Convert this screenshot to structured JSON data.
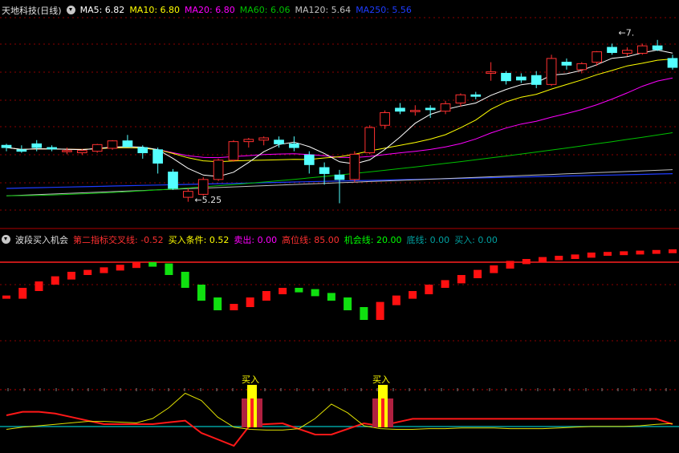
{
  "colors": {
    "bg": "#000000",
    "up": "#ff3030",
    "down": "#54ffff",
    "grid": "#8b0000",
    "ma5": "#ffffff",
    "ma10": "#ffff00",
    "ma20": "#ff00ff",
    "ma60": "#00c000",
    "ma120": "#c0c0c0",
    "ma250": "#1e3cff"
  },
  "main_header": {
    "title": "天地科技(日线)",
    "items": [
      {
        "label": "MA5: 6.82",
        "color": "#ffffff"
      },
      {
        "label": "MA10: 6.80",
        "color": "#ffff00"
      },
      {
        "label": "MA20: 6.80",
        "color": "#ff00ff"
      },
      {
        "label": "MA60: 6.06",
        "color": "#00c000"
      },
      {
        "label": "MA120: 5.64",
        "color": "#c0c0c0"
      },
      {
        "label": "MA250: 5.56",
        "color": "#1e3cff"
      }
    ]
  },
  "sub_header": {
    "title": "波段买入机会",
    "items": [
      {
        "label": "第二指标交叉线: -0.52",
        "color": "#ff3030"
      },
      {
        "label": "买入条件: 0.52",
        "color": "#ffff00"
      },
      {
        "label": "卖出: 0.00",
        "color": "#ff00ff"
      },
      {
        "label": "高位线: 85.00",
        "color": "#ff3030"
      },
      {
        "label": "机会线: 20.00",
        "color": "#00ff00"
      },
      {
        "label": "底线: 0.00",
        "color": "#00a0a0"
      },
      {
        "label": "买入: 0.00",
        "color": "#00a0a0"
      }
    ]
  },
  "chart_data": [
    {
      "type": "candlestick",
      "ylim": [
        5.0,
        7.7
      ],
      "annotations": [
        {
          "text": "5.25",
          "value": 5.25,
          "index": 12
        },
        {
          "text": "7.",
          "value": 7.5,
          "index": 40
        }
      ],
      "candles": [
        [
          5.98,
          6.0,
          5.9,
          5.95
        ],
        [
          5.92,
          5.98,
          5.88,
          5.9
        ],
        [
          6.0,
          6.05,
          5.9,
          5.95
        ],
        [
          5.95,
          5.98,
          5.9,
          5.93
        ],
        [
          5.9,
          5.95,
          5.86,
          5.91
        ],
        [
          5.88,
          5.93,
          5.85,
          5.91
        ],
        [
          5.9,
          6.0,
          5.88,
          5.99
        ],
        [
          5.94,
          6.05,
          5.92,
          6.04
        ],
        [
          6.04,
          6.12,
          5.98,
          5.96
        ],
        [
          5.95,
          5.98,
          5.8,
          5.88
        ],
        [
          5.92,
          5.95,
          5.6,
          5.74
        ],
        [
          5.62,
          5.66,
          5.38,
          5.4
        ],
        [
          5.28,
          5.4,
          5.22,
          5.36
        ],
        [
          5.32,
          5.55,
          5.3,
          5.52
        ],
        [
          5.52,
          5.8,
          5.5,
          5.78
        ],
        [
          5.78,
          6.05,
          5.76,
          6.03
        ],
        [
          6.03,
          6.08,
          5.95,
          6.06
        ],
        [
          6.05,
          6.1,
          5.98,
          6.08
        ],
        [
          6.05,
          6.1,
          5.95,
          6.0
        ],
        [
          6.0,
          6.1,
          5.9,
          5.95
        ],
        [
          5.85,
          5.9,
          5.6,
          5.72
        ],
        [
          5.68,
          5.75,
          5.45,
          5.6
        ],
        [
          5.58,
          5.65,
          5.2,
          5.52
        ],
        [
          5.52,
          5.9,
          5.48,
          5.86
        ],
        [
          5.88,
          6.25,
          5.86,
          6.22
        ],
        [
          6.25,
          6.45,
          6.2,
          6.42
        ],
        [
          6.48,
          6.55,
          6.4,
          6.44
        ],
        [
          6.45,
          6.52,
          6.38,
          6.45
        ],
        [
          6.48,
          6.52,
          6.35,
          6.46
        ],
        [
          6.44,
          6.58,
          6.4,
          6.54
        ],
        [
          6.55,
          6.68,
          6.5,
          6.66
        ],
        [
          6.66,
          6.7,
          6.6,
          6.64
        ],
        [
          6.95,
          7.1,
          6.85,
          6.97
        ],
        [
          6.95,
          6.98,
          6.8,
          6.85
        ],
        [
          6.9,
          6.95,
          6.82,
          6.86
        ],
        [
          6.92,
          6.98,
          6.75,
          6.8
        ],
        [
          6.8,
          7.2,
          6.78,
          7.15
        ],
        [
          7.1,
          7.15,
          7.0,
          7.06
        ],
        [
          7.0,
          7.1,
          6.95,
          7.08
        ],
        [
          7.1,
          7.25,
          7.05,
          7.24
        ],
        [
          7.3,
          7.35,
          7.2,
          7.23
        ],
        [
          7.22,
          7.3,
          7.18,
          7.26
        ],
        [
          7.22,
          7.35,
          7.2,
          7.32
        ],
        [
          7.32,
          7.4,
          7.25,
          7.27
        ],
        [
          7.15,
          7.2,
          7.0,
          7.03
        ]
      ]
    },
    {
      "type": "bar",
      "series": [
        {
          "name": "第二指标交叉线",
          "values": [
            -0.52,
            -0.4,
            -0.3,
            -0.22,
            -0.15,
            -0.12,
            -0.08,
            -0.04,
            0.0,
            -0.02,
            -0.15,
            -0.35,
            -0.55,
            -0.7,
            -0.65,
            -0.55,
            -0.45,
            -0.4,
            -0.42,
            -0.48,
            -0.55,
            -0.7,
            -0.85,
            -0.62,
            -0.52,
            -0.45,
            -0.35,
            -0.28,
            -0.2,
            -0.12,
            -0.05,
            0.02,
            0.05,
            0.08,
            0.1,
            0.12,
            0.15,
            0.16,
            0.17,
            0.18,
            0.19,
            0.2
          ]
        }
      ]
    },
    {
      "type": "line",
      "ylim": [
        0,
        100
      ],
      "buy_labels": [
        "买入",
        "买入"
      ],
      "series": [
        {
          "values": [
            20,
            22,
            22,
            21,
            19,
            17,
            15,
            15,
            15,
            15,
            16,
            17,
            16,
            15,
            14,
            14,
            15,
            15,
            15,
            14,
            13,
            12,
            12,
            14,
            16,
            18,
            18,
            18,
            18,
            18,
            18,
            18,
            18,
            18,
            18,
            18,
            18,
            18,
            18,
            18,
            18,
            15
          ]
        },
        {
          "values": [
            5,
            8,
            10,
            12,
            14,
            16,
            16,
            15,
            14,
            20,
            35,
            55,
            45,
            22,
            8,
            5,
            4,
            4,
            6,
            20,
            40,
            28,
            10,
            6,
            5,
            5,
            6,
            6,
            7,
            7,
            7,
            6,
            6,
            6,
            7,
            8,
            9,
            9,
            9,
            10,
            12,
            13
          ]
        }
      ]
    }
  ]
}
